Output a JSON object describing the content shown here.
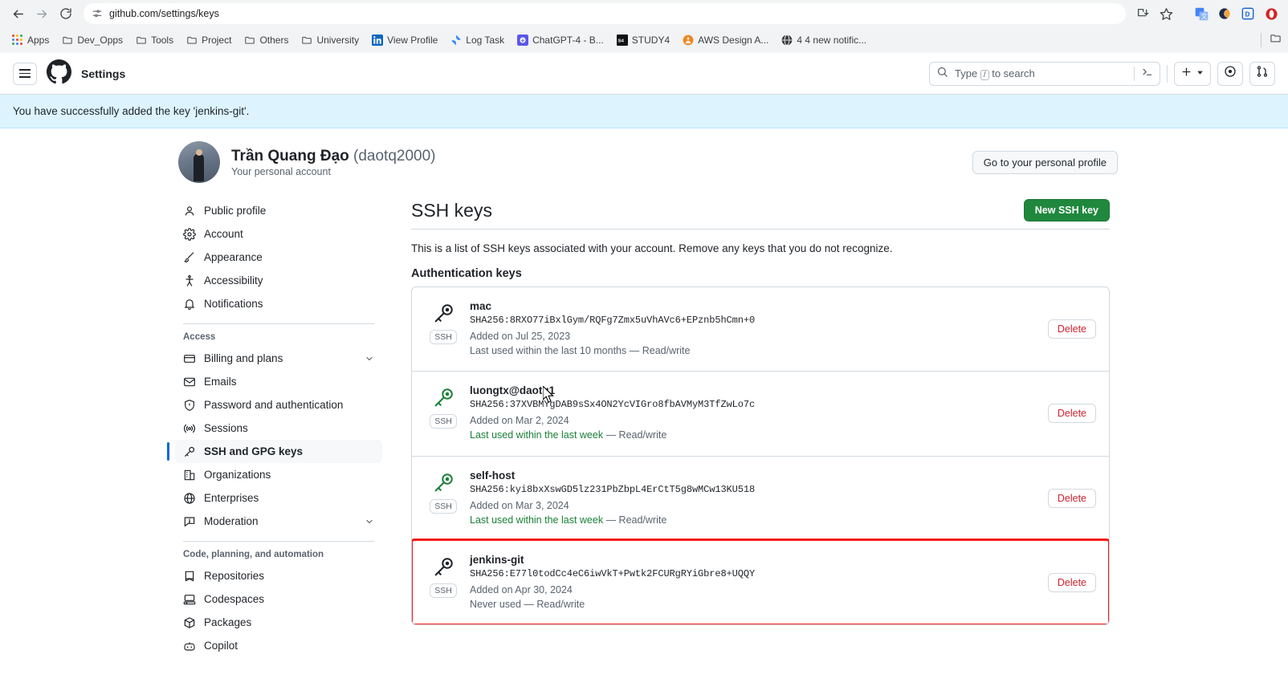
{
  "browser": {
    "back_icon": "back-arrow-icon",
    "forward_icon": "forward-arrow-icon",
    "reload_icon": "reload-icon",
    "url": "github.com/settings/keys",
    "site_info_icon": "site-settings-icon",
    "install_icon": "install-app-icon",
    "bookmark_star_icon": "bookmark-star-icon",
    "extensions": [
      {
        "name": "google-translate-extension-icon",
        "color": "#4285f4"
      },
      {
        "name": "grammarly-extension-icon",
        "color": "#11a683"
      },
      {
        "name": "dashlane-extension-icon",
        "color": "#0e5fd8"
      },
      {
        "name": "opera-extension-icon",
        "color": "#d32424"
      }
    ],
    "bookmarks": [
      {
        "label": "Apps",
        "icon": "apps-grid-icon",
        "color": "#4285f4"
      },
      {
        "label": "Dev_Opps",
        "icon": "folder-icon",
        "color": "#5f6368"
      },
      {
        "label": "Tools",
        "icon": "folder-icon",
        "color": "#5f6368"
      },
      {
        "label": "Project",
        "icon": "folder-icon",
        "color": "#5f6368"
      },
      {
        "label": "Others",
        "icon": "folder-icon",
        "color": "#5f6368"
      },
      {
        "label": "University",
        "icon": "folder-icon",
        "color": "#5f6368"
      },
      {
        "label": "View Profile",
        "icon": "linkedin-icon",
        "color": "#0a66c2"
      },
      {
        "label": "Log Task",
        "icon": "jira-icon",
        "color": "#2684ff"
      },
      {
        "label": "ChatGPT-4 - B...",
        "icon": "chatgpt-icon",
        "color": "#5a57e8"
      },
      {
        "label": "STUDY4",
        "icon": "study4-icon",
        "color": "#111111"
      },
      {
        "label": "AWS Design A...",
        "icon": "aws-icon",
        "color": "#ef8620"
      },
      {
        "label": "4 4 new notific...",
        "icon": "globe-icon",
        "color": "#3c4043"
      }
    ]
  },
  "gh_header": {
    "menu_icon": "hamburger-menu-icon",
    "logo_icon": "github-mark-icon",
    "title": "Settings",
    "search_placeholder": "Type",
    "search_kbd": "/",
    "search_suffix": "to search",
    "search_icon": "search-icon",
    "command_icon": "command-palette-icon",
    "create_icon": "plus-icon",
    "create_caret": "chevron-down-icon",
    "issues_icon": "issue-opened-icon",
    "pulls_icon": "git-pull-request-icon"
  },
  "flash": {
    "message": "You have successfully added the key 'jenkins-git'.",
    "bg_color": "#ddf4ff"
  },
  "profile": {
    "name": "Trần Quang Đạo",
    "handle": "(daotq2000)",
    "subtitle": "Your personal account",
    "avatar_icon": "user-avatar",
    "profile_button": "Go to your personal profile"
  },
  "sidebar": {
    "top_items": [
      {
        "label": "Public profile",
        "icon": "person-icon"
      },
      {
        "label": "Account",
        "icon": "gear-icon"
      },
      {
        "label": "Appearance",
        "icon": "paintbrush-icon"
      },
      {
        "label": "Accessibility",
        "icon": "accessibility-icon"
      },
      {
        "label": "Notifications",
        "icon": "bell-icon"
      }
    ],
    "access_group": {
      "title": "Access",
      "items": [
        {
          "label": "Billing and plans",
          "icon": "credit-card-icon",
          "expandable": true
        },
        {
          "label": "Emails",
          "icon": "mail-icon",
          "expandable": false
        },
        {
          "label": "Password and authentication",
          "icon": "shield-lock-icon",
          "expandable": false
        },
        {
          "label": "Sessions",
          "icon": "broadcast-icon",
          "expandable": false
        },
        {
          "label": "SSH and GPG keys",
          "icon": "key-icon",
          "expandable": false,
          "selected": true
        },
        {
          "label": "Organizations",
          "icon": "organization-icon",
          "expandable": false
        },
        {
          "label": "Enterprises",
          "icon": "globe-icon",
          "expandable": false
        },
        {
          "label": "Moderation",
          "icon": "report-icon",
          "expandable": true
        }
      ]
    },
    "code_group": {
      "title": "Code, planning, and automation",
      "items": [
        {
          "label": "Repositories",
          "icon": "repo-icon"
        },
        {
          "label": "Codespaces",
          "icon": "codespaces-icon"
        },
        {
          "label": "Packages",
          "icon": "package-icon"
        },
        {
          "label": "Copilot",
          "icon": "copilot-icon"
        }
      ]
    }
  },
  "main": {
    "heading": "SSH keys",
    "new_key_button": "New SSH key",
    "lead": "This is a list of SSH keys associated with your account. Remove any keys that you do not recognize.",
    "section_title": "Authentication keys",
    "delete_label": "Delete",
    "ssh_tag": "SSH",
    "keys": [
      {
        "title": "mac",
        "fingerprint": "SHA256:8RXO77iBxlGym/RQFg7Zmx5uVhAVc6+EPznb5hCmn+0",
        "added": "Added on Jul 25, 2023",
        "last_used": "Last used within the last 10 months",
        "permission": "— Read/write",
        "active": false
      },
      {
        "title": "luongtx@daotq1",
        "fingerprint": "SHA256:37XVBMYgDAB9sSx4ON2YcVIGro8fbAVMyM3TfZwLo7c",
        "added": "Added on Mar 2, 2024",
        "last_used": "Last used within the last week",
        "permission": "— Read/write",
        "active": true
      },
      {
        "title": "self-host",
        "fingerprint": "SHA256:kyi8bxXswGD5lz231PbZbpL4ErCtT5g8wMCw13KU518",
        "added": "Added on Mar 3, 2024",
        "last_used": "Last used within the last week",
        "permission": "— Read/write",
        "active": true
      },
      {
        "title": "jenkins-git",
        "fingerprint": "SHA256:E77l0todCc4eC6iwVkT+Pwtk2FCURgRYiGbre8+UQQY",
        "added": "Added on Apr 30, 2024",
        "last_used": "Never used",
        "permission": "— Read/write",
        "active": false,
        "highlighted": true
      }
    ]
  },
  "annotation": {
    "highlight_color": "#f51919"
  }
}
